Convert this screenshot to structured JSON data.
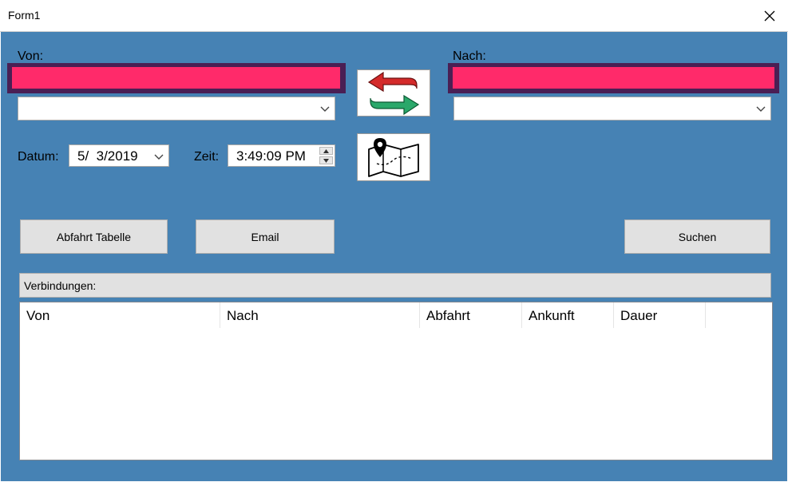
{
  "window": {
    "title": "Form1"
  },
  "form": {
    "von_label": "Von:",
    "nach_label": "Nach:",
    "von_input_value": "",
    "nach_input_value": "",
    "datum_label": "Datum:",
    "datum_value": "5/  3/2019",
    "zeit_label": "Zeit:",
    "zeit_value": "3:49:09 PM",
    "input_color": "#ff2a6a",
    "input_border_color": "#4a1f54",
    "background_color": "#4682b4"
  },
  "buttons": {
    "swap_icon": "swap-arrows-icon",
    "map_icon": "map-pin-icon",
    "abfahrt_tabelle": "Abfahrt Tabelle",
    "email": "Email",
    "suchen": "Suchen"
  },
  "verbindungen": {
    "label": "Verbindungen:",
    "columns": [
      "Von",
      "Nach",
      "Abfahrt",
      "Ankunft",
      "Dauer"
    ],
    "rows": []
  }
}
